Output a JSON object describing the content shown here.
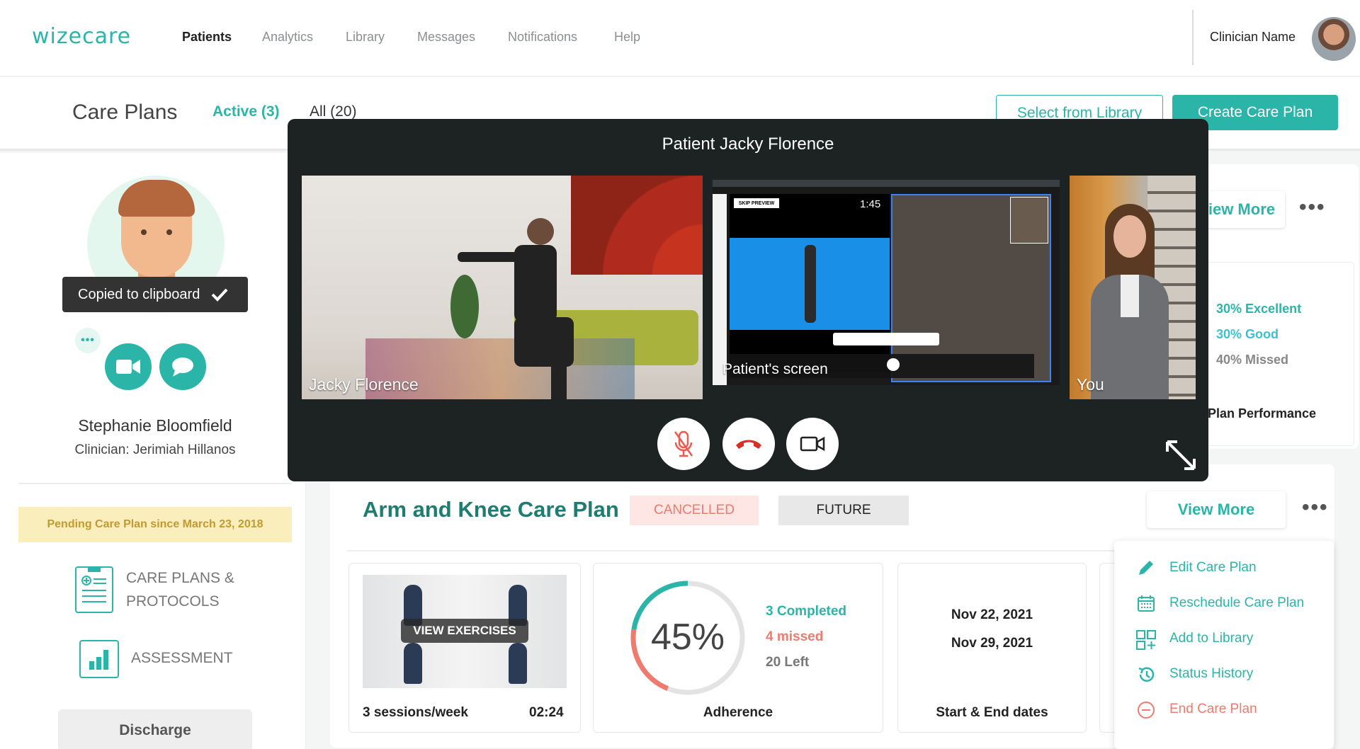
{
  "nav": {
    "logo": "wizecare",
    "items": [
      "Patients",
      "Analytics",
      "Library",
      "Messages",
      "Notifications",
      "Help"
    ],
    "clinician": "Clinician Name"
  },
  "header": {
    "title": "Care Plans",
    "tab_active": "Active (3)",
    "tab_all": "All (20)",
    "select_library": "Select from Library",
    "create_plan": "Create Care Plan"
  },
  "patient": {
    "toast": "Copied to clipboard",
    "name": "Stephanie Bloomfield",
    "clinician": "Clinician: Jerimiah Hillanos",
    "pending": "Pending Care Plan since March 23, 2018",
    "menu_care_line1": "CARE PLANS &",
    "menu_care_line2": "PROTOCOLS",
    "menu_assessment": "ASSESSMENT",
    "discharge": "Discharge"
  },
  "top_card": {
    "view_more": "View More",
    "excellent": "30% Excellent",
    "good": "30% Good",
    "missed": "40% Missed",
    "perf_label": "Plan Performance"
  },
  "plan": {
    "title": "Arm and Knee Care Plan",
    "badge_cancelled": "CANCELLED",
    "badge_future": "FUTURE",
    "view_more": "View More",
    "view_exercises": "VIEW EXERCISES",
    "sessions": "3 sessions/week",
    "duration": "02:24",
    "adherence_pct": "45%",
    "adherence_value": 0.45,
    "completed": "3 Completed",
    "missed": "4 missed",
    "left": "20 Left",
    "adherence_label": "Adherence",
    "start_date": "Nov 22, 2021",
    "end_date": "Nov 29, 2021",
    "dates_label": "Start & End dates"
  },
  "dropdown": {
    "edit": "Edit Care Plan",
    "reschedule": "Reschedule Care Plan",
    "add_library": "Add to Library",
    "status_history": "Status History",
    "end": "End Care Plan"
  },
  "video": {
    "title": "Patient Jacky Florence",
    "patient_label": "Jacky Florence",
    "screen_label": "Patient's screen",
    "self_label": "You",
    "screen_timer": "1:45",
    "skip_preview": "SKIP PREVIEW"
  },
  "colors": {
    "accent": "#2bb5a8",
    "danger": "#ef7a6e",
    "dark": "#1c2322"
  }
}
